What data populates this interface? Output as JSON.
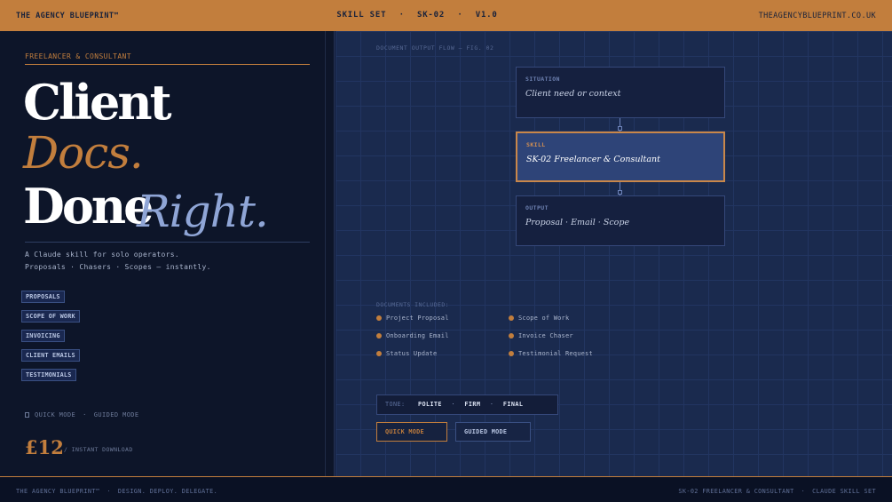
{
  "topbar": {
    "brand": "THE AGENCY BLUEPRINT™",
    "center_a": "SKILL SET",
    "center_b": "SK-02",
    "center_c": "V1.0",
    "separator": "·",
    "url": "THEAGENCYBLUEPRINT.CO.UK"
  },
  "hero": {
    "eyebrow": "FREELANCER & CONSULTANT",
    "line1": "Client",
    "line2": "Docs.",
    "line3a": "Done",
    "line3b": "Right.",
    "desc1": "A Claude skill for solo operators.",
    "desc2": "Proposals · Chasers · Scopes — instantly."
  },
  "tags": [
    "PROPOSALS",
    "SCOPE OF WORK",
    "INVOICING",
    "CLIENT EMAILS",
    "TESTIMONIALS"
  ],
  "modes": {
    "quick": "QUICK MODE",
    "separator": "·",
    "guided": "GUIDED MODE"
  },
  "price": {
    "amount": "£12",
    "note": "/ INSTANT DOWNLOAD"
  },
  "flow": {
    "caption": "DOCUMENT OUTPUT FLOW — FIG. 02",
    "cards": [
      {
        "label": "SITUATION",
        "text": "Client need or context"
      },
      {
        "label": "SKILL",
        "text": "SK-02 Freelancer & Consultant"
      },
      {
        "label": "OUTPUT",
        "text": "Proposal · Email · Scope"
      }
    ]
  },
  "documents": {
    "caption": "DOCUMENTS INCLUDED:",
    "col1": [
      "Project Proposal",
      "Onboarding Email",
      "Status Update"
    ],
    "col2": [
      "Scope of Work",
      "Invoice Chaser",
      "Testimonial Request"
    ]
  },
  "tone": {
    "label": "TONE:",
    "values": [
      "POLITE",
      "FIRM",
      "FINAL"
    ],
    "separator": "·"
  },
  "buttons": {
    "quick": "QUICK MODE",
    "guided": "GUIDED MODE"
  },
  "footer": {
    "left_a": "THE AGENCY BLUEPRINT™",
    "left_b": "DESIGN. DEPLOY. DELEGATE.",
    "right_a": "SK-02 FREELANCER & CONSULTANT",
    "right_b": "CLAUDE SKILL SET",
    "separator": "·"
  },
  "colors": {
    "accent": "#c27e3d",
    "panel_dark": "#0d1529",
    "panel_blue": "#1a2a4e",
    "highlight_card": "#2e4478",
    "italic_blue": "#8fa5d6"
  }
}
